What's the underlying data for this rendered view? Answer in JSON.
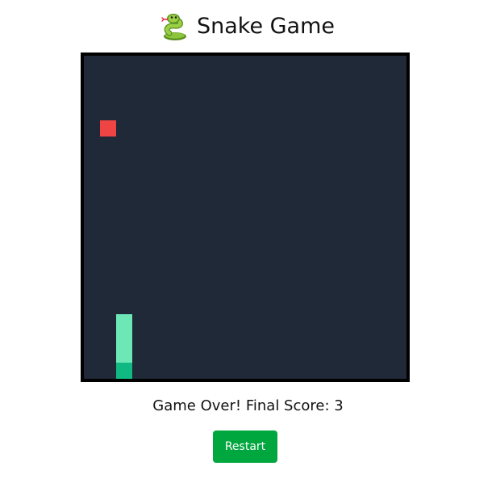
{
  "title": {
    "icon": "snake-icon",
    "text": "Snake Game"
  },
  "board": {
    "grid_cols": 20,
    "grid_rows": 20,
    "background_color": "#1f2937",
    "border_color": "#000000",
    "food": {
      "col": 1,
      "row": 4,
      "color": "#ef4444"
    },
    "snake": {
      "head_color": "#10b981",
      "body_color": "#6ee7b7",
      "segments": [
        {
          "col": 2,
          "row": 19
        },
        {
          "col": 2,
          "row": 18
        },
        {
          "col": 2,
          "row": 17
        },
        {
          "col": 2,
          "row": 16
        }
      ]
    }
  },
  "status": {
    "text": "Game Over! Final Score: 3"
  },
  "controls": {
    "restart_label": "Restart",
    "restart_color": "#00a63e"
  }
}
